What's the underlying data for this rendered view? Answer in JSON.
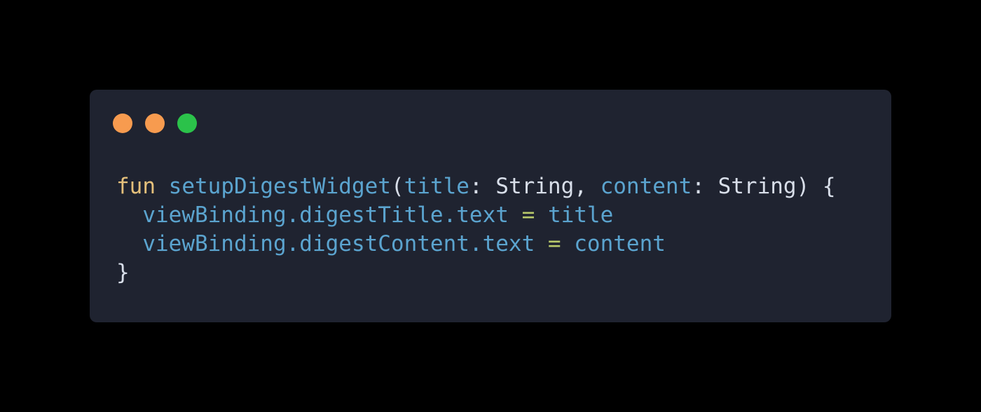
{
  "window": {
    "controls": [
      {
        "name": "close",
        "color": "#f79b4f"
      },
      {
        "name": "minimize",
        "color": "#f79b4f"
      },
      {
        "name": "maximize",
        "color": "#2bc24a"
      }
    ]
  },
  "code": {
    "line1": {
      "kw": "fun",
      "fn": "setupDigestWidget",
      "open": "(",
      "p1": "title",
      "colon1": ": ",
      "t1": "String",
      "comma": ", ",
      "p2": "content",
      "colon2": ": ",
      "t2": "String",
      "close": ")",
      "brace": " {"
    },
    "line2": {
      "indent": "  ",
      "lhs": "viewBinding.digestTitle.text",
      "eq": "=",
      "rhs": "title"
    },
    "line3": {
      "indent": "  ",
      "lhs": "viewBinding.digestContent.text",
      "eq": "=",
      "rhs": "content"
    },
    "line4": {
      "brace": "}"
    }
  }
}
